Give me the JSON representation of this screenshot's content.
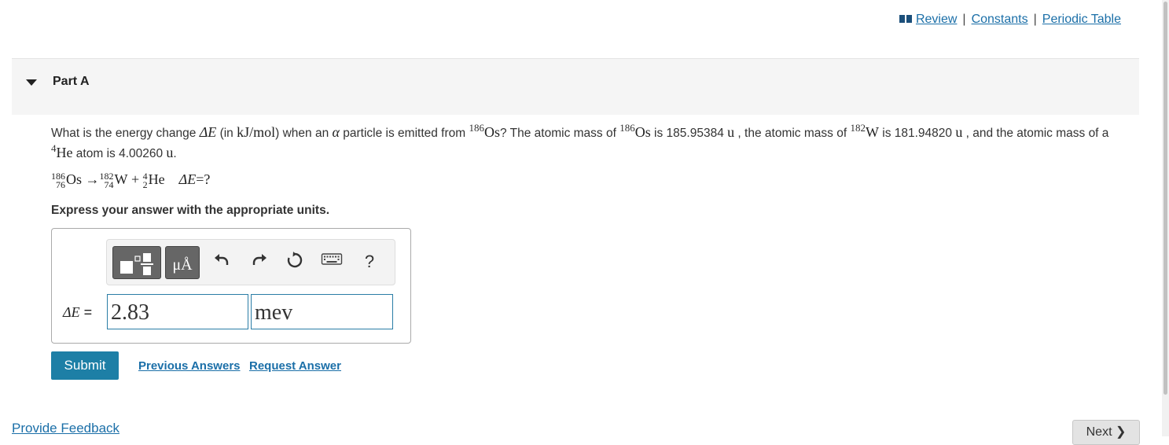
{
  "top_links": {
    "review": "Review",
    "constants": "Constants",
    "periodic_table": "Periodic Table",
    "separator": "|"
  },
  "part": {
    "title": "Part A"
  },
  "question": {
    "t1": "What is the energy change ",
    "dE": "ΔE",
    "t2": " (in ",
    "unit": "kJ/mol",
    "t3": ") when an ",
    "alpha": "α",
    "t4": " particle is emitted from ",
    "os_mass_num": "186",
    "os": "Os",
    "t5": "? The atomic mass of ",
    "t6": " is 185.95384 ",
    "u": "u",
    "t7": " , the atomic mass of ",
    "w_mass_num": "182",
    "w": "W",
    "t8": " is 181.94820 ",
    "t9": " , and the atomic mass of a ",
    "he_mass_num": "4",
    "he": "He",
    "t10": " atom is 4.00260 ",
    "t11": "."
  },
  "equation": {
    "os_a": "186",
    "os_z": "76",
    "os": "Os",
    "arrow": "→",
    "w_a": "182",
    "w_z": "74",
    "w": "W",
    "plus": "+",
    "he_a": "4",
    "he_z": "2",
    "he": "He",
    "dE": "ΔE",
    "eq": "=?"
  },
  "instruction": "Express your answer with the appropriate units.",
  "answer": {
    "label_var": "ΔE",
    "label_eq": " =",
    "value": "2.83",
    "units": "mev",
    "units_button": "μÅ",
    "help": "?"
  },
  "buttons": {
    "submit": "Submit",
    "previous_answers": "Previous Answers",
    "request_answer": "Request Answer"
  },
  "footer": {
    "feedback": "Provide Feedback",
    "next": "Next ❯"
  },
  "colors": {
    "accent": "#1d7fa6",
    "link": "#1b6fa8"
  }
}
